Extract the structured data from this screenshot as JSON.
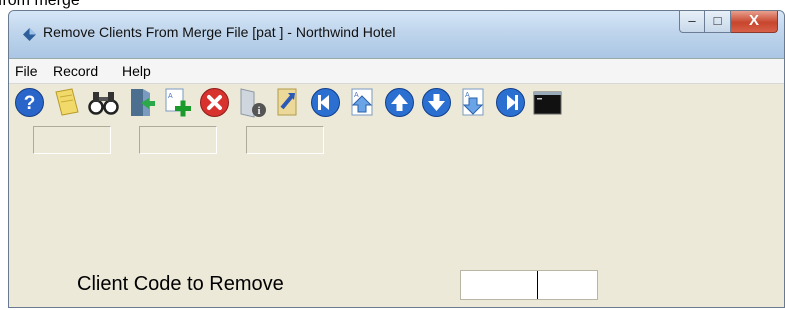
{
  "caption": "from merge",
  "window": {
    "title": "Remove Clients From Merge File [pat    ] - Northwind Hotel",
    "buttons": {
      "minimize": "–",
      "maximize": "□",
      "close": "X"
    }
  },
  "menu": [
    "File",
    "Record",
    "Help"
  ],
  "toolbar": [
    "help-icon",
    "notes-icon",
    "binoculars-icon",
    "exit-door-icon",
    "add-record-icon",
    "delete-icon",
    "info-icon",
    "sort-icon",
    "first-record-icon",
    "previous-page-icon",
    "previous-record-icon",
    "next-record-icon",
    "next-page-icon",
    "last-record-icon",
    "terminal-icon"
  ],
  "form": {
    "client_code_label": "Client Code to Remove",
    "client_code_value": ""
  }
}
